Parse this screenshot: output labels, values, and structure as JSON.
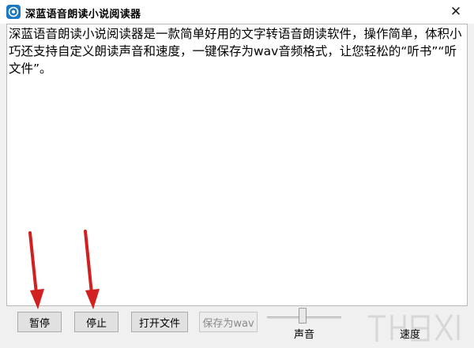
{
  "window": {
    "title": "深蓝语音朗读小说阅读器",
    "close_glyph": "✕"
  },
  "editor": {
    "content": "深蓝语音朗读小说阅读器是一款简单好用的文字转语音朗读软件，操作简单，体积小巧还支持自定义朗读声音和速度，一键保存为wav音频格式，让您轻松的“听书”“听文件”。"
  },
  "toolbar": {
    "pause_label": "暂停",
    "stop_label": "停止",
    "open_file_label": "打开文件",
    "save_wav_label": "保存为wav"
  },
  "sliders": {
    "volume_label": "声音",
    "speed_label": "速度"
  },
  "colors": {
    "annotation_arrow": "#d21f1f",
    "app_icon": "#1a78c2"
  },
  "icons": {
    "app": "app-logo-icon",
    "close": "close-icon"
  }
}
